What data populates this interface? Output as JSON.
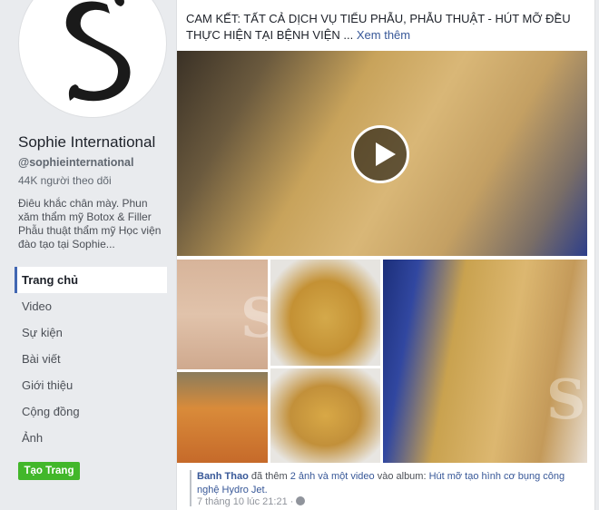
{
  "sidebar": {
    "page_name": "Sophie International",
    "handle": "@sophieinternational",
    "followers": "44K người theo dõi",
    "about": "Điêu khắc chân mày. Phun xăm thẩm mỹ Botox & Filler Phẫu thuật thẩm mỹ Học viện đào tạo tại Sophie...",
    "nav": [
      {
        "label": "Trang chủ"
      },
      {
        "label": "Video"
      },
      {
        "label": "Sự kiện"
      },
      {
        "label": "Bài viết"
      },
      {
        "label": "Giới thiệu"
      },
      {
        "label": "Cộng đồng"
      },
      {
        "label": "Ảnh"
      }
    ],
    "create_page": "Tạo Trang"
  },
  "post": {
    "text": "CAM KẾT: TẤT CẢ DỊCH VỤ TIỂU PHẪU, PHẪU THUẬT - HÚT MỠ ĐỀU THỰC HIỆN TẠI BỆNH VIỆN ...",
    "see_more": "Xem thêm",
    "caption": {
      "author": "Banh Thao",
      "action": " đã thêm ",
      "added": "2 ảnh và một video",
      "into": " vào album: ",
      "album": "Hút mỡ tạo hình cơ bụng công nghệ Hydro Jet.",
      "time": "7 tháng 10 lúc 21:21 ·"
    }
  },
  "icons": {
    "play": "play-icon",
    "globe": "globe-icon"
  },
  "colors": {
    "accent": "#4267b2",
    "link": "#385898",
    "create_button": "#42b72a"
  }
}
